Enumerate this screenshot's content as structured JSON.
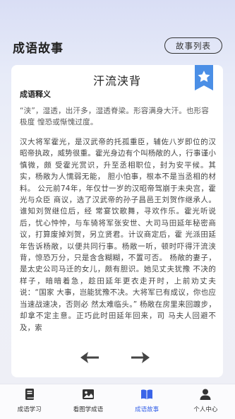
{
  "header": {
    "title": "成语故事",
    "list_button": "故事列表"
  },
  "story": {
    "title": "汗流浃背",
    "meaning_label": "成语释义",
    "meaning": "“浃”，湿透，出汗多，湿透脊梁。形容满身大汗。也形容极度 惶恐或惭愧过度。",
    "content": "汉大将军霍光，是汉武帝的托孤重臣，辅佐八岁即位的汉 昭帝执政，威势很重。霍光身边有个叫杨敞的人，行事谨小慎微，颇 受霍光赏识，升至丞相职位，封为安平候。其实，杨敞为人懦弱无能， 胆小怕事，根本不是当丞相的材料。 公元前74年，年仅廿一岁的汉昭帝驾崩于未央宫，霍光与众臣 商议，选了汉武帝的孙子昌邑王刘贺作继承人。谁知刘贺继位后，经 常宴饮歌舞，寻欢作乐。霍光听说后，忧心忡忡，与车骑将军张安世、大司马田延年秘密商议，打算废掉刘贺，另立贤君。计议商定后，霍 光派田延年告诉杨敞，以便共同行事。杨敞一听，顿时吓得汗流浃 背，惊恐万分，只是含含糊糊，不置可否。 杨敞的妻子，是太史公司马迁的女儿，颇有胆识。她见丈夫犹豫 不决的样子，暗暗着急，趁田延年更衣走开时，上前劝丈夫说：“国家 大事，岂能犹豫不决。大将军已有成议，你也应当速战速决，否则必 然太难临头。” 杨敞在房里来回踱步，却拿不定主意。正巧此时田延年回来，司 马夫人回避不及，索"
  },
  "tabs": [
    {
      "label": "成语学习",
      "icon": "book-icon"
    },
    {
      "label": "看图学成语",
      "icon": "image-icon"
    },
    {
      "label": "成语故事",
      "icon": "open-book-icon"
    },
    {
      "label": "个人中心",
      "icon": "user-icon"
    }
  ],
  "colors": {
    "accent": "#3a64e8",
    "bookmark": "#4b8fe6"
  }
}
